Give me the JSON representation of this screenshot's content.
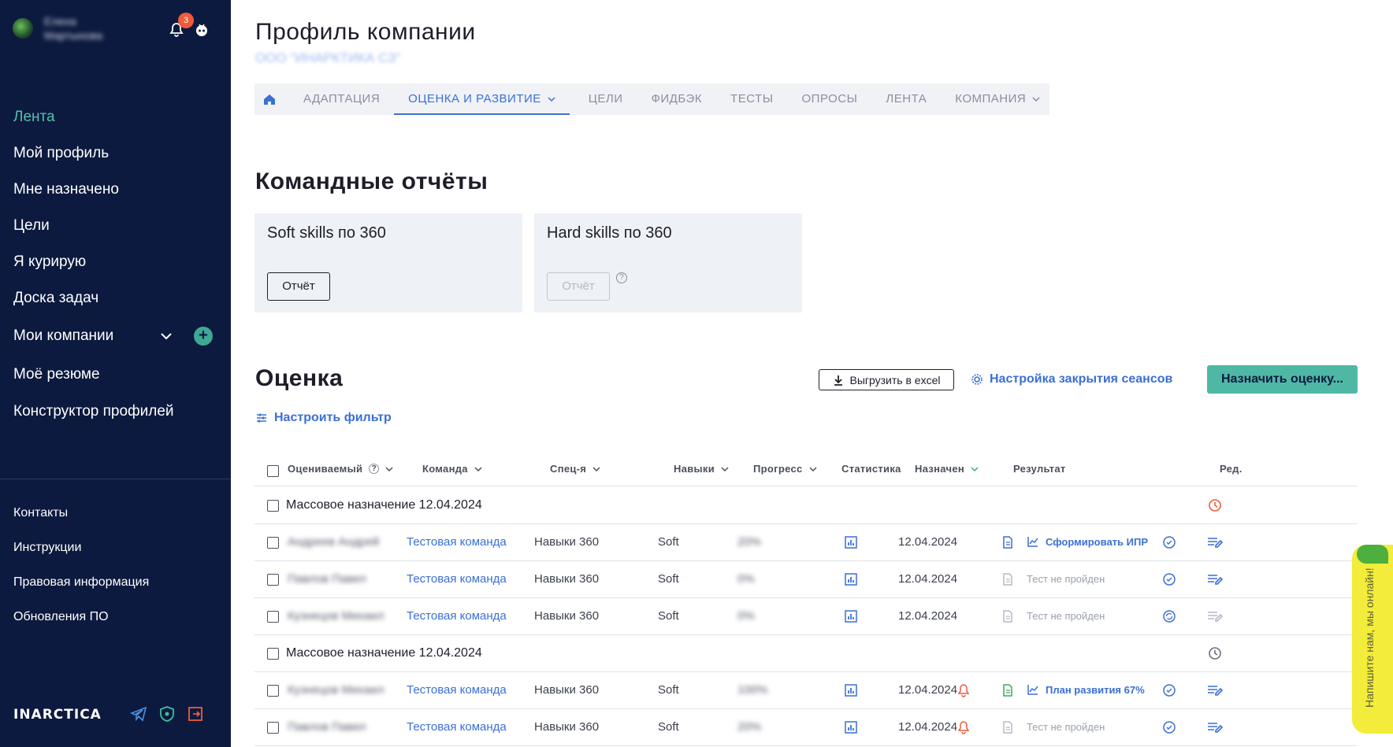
{
  "sidebar": {
    "user_name": "Елена Мартынова",
    "notifications_count": "3",
    "nav": [
      {
        "label": "Лента",
        "active": true
      },
      {
        "label": "Мой профиль"
      },
      {
        "label": "Мне назначено"
      },
      {
        "label": "Цели"
      },
      {
        "label": "Я курирую"
      },
      {
        "label": "Доска задач"
      },
      {
        "label": "Мои компании"
      },
      {
        "label": "Моё резюме"
      },
      {
        "label": "Конструктор профилей"
      }
    ],
    "nav2": [
      "Контакты",
      "Инструкции",
      "Правовая информация",
      "Обновления ПО"
    ],
    "brand": "INARCTICA"
  },
  "header": {
    "title": "Профиль компании",
    "company": "ООО \"ИНАРКТИКА СЗ\""
  },
  "tabs": [
    "АДАПТАЦИЯ",
    "ОЦЕНКА И РАЗВИТИЕ",
    "ЦЕЛИ",
    "ФИДБЭК",
    "ТЕСТЫ",
    "ОПРОСЫ",
    "ЛЕНТА",
    "КОМПАНИЯ"
  ],
  "team_reports": {
    "title": "Командные отчёты",
    "cards": [
      {
        "title": "Soft skills по 360",
        "button": "Отчёт"
      },
      {
        "title": "Hard skills по 360",
        "button": "Отчёт"
      }
    ]
  },
  "assessment": {
    "title": "Оценка",
    "export": "Выгрузить в excel",
    "settings": "Настройка закрытия сеансов",
    "assign": "Назначить оценку...",
    "filter": "Настроить фильтр",
    "columns": [
      "Оцениваемый",
      "Команда",
      "Спец-я",
      "Навыки",
      "Прогресс",
      "Статистика",
      "Назначен",
      "Результат",
      "Ред."
    ],
    "groups": [
      {
        "label": "Массовое назначение 12.04.2024",
        "rows": [
          {
            "name": "Андреев Андрей",
            "team": "Тестовая команда",
            "spec": "Навыки 360",
            "skills": "Soft",
            "progress": "20%",
            "date": "12.04.2024",
            "result": "Сформировать ИПР"
          },
          {
            "name": "Павлов Павел",
            "team": "Тестовая команда",
            "spec": "Навыки 360",
            "skills": "Soft",
            "progress": "0%",
            "date": "12.04.2024",
            "result": "Тест не пройден"
          },
          {
            "name": "Кузнецов Михаил",
            "team": "Тестовая команда",
            "spec": "Навыки 360",
            "skills": "Soft",
            "progress": "0%",
            "date": "12.04.2024",
            "result": "Тест не пройден"
          }
        ]
      },
      {
        "label": "Массовое назначение 12.04.2024",
        "rows": [
          {
            "name": "Кузнецов Михаил",
            "team": "Тестовая команда",
            "spec": "Навыки 360",
            "skills": "Soft",
            "progress": "100%",
            "date": "12.04.2024",
            "result": "План развития 67%"
          },
          {
            "name": "Павлов Павел",
            "team": "Тестовая команда",
            "spec": "Навыки 360",
            "skills": "Soft",
            "progress": "20%",
            "date": "12.04.2024",
            "result": "Тест не пройден"
          }
        ]
      }
    ]
  },
  "chat": {
    "label": "Напишите нам, мы онлайн!"
  },
  "colors": {
    "sidebar": "#0d1a3f",
    "accent": "#3b6fd4",
    "teal": "#4fb8a5",
    "warn": "#f05a3c"
  }
}
